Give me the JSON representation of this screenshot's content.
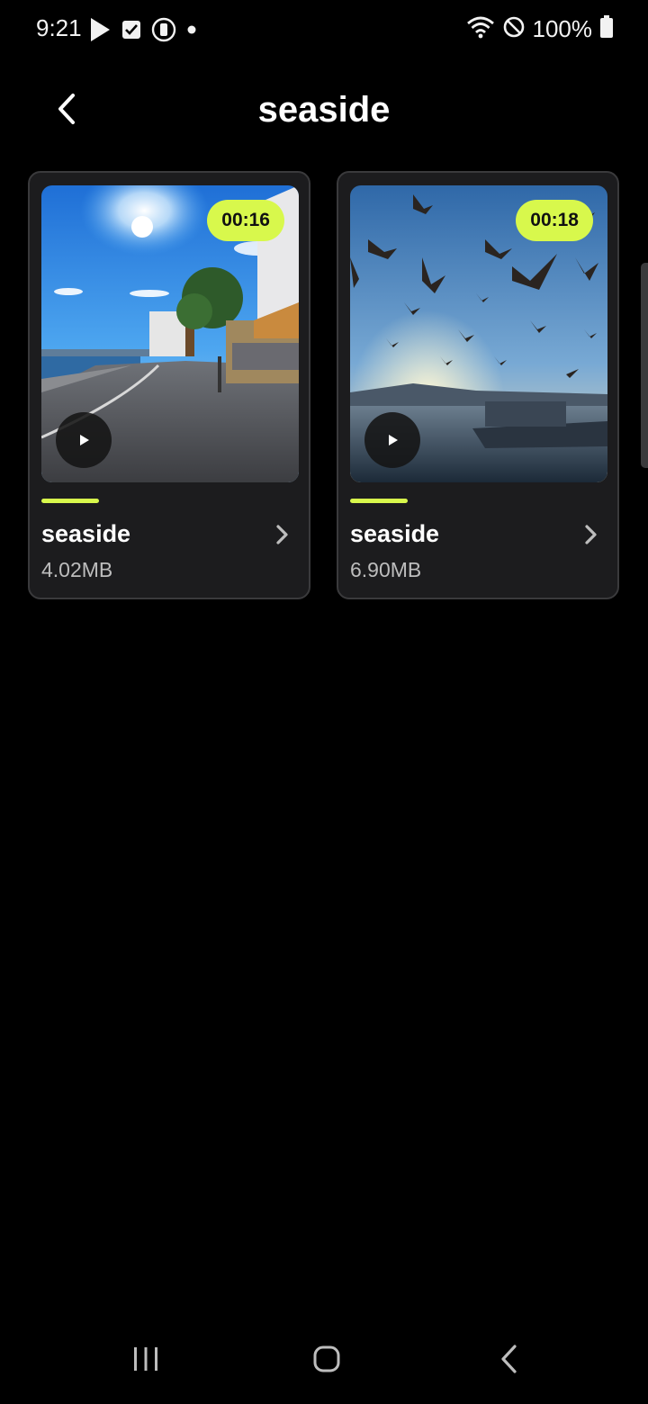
{
  "status_bar": {
    "time": "9:21",
    "left_icons": [
      "play-store-icon",
      "checkbox-icon",
      "recorder-icon",
      "dot-icon"
    ],
    "right_icons": [
      "wifi-icon",
      "do-not-disturb-icon",
      "battery-icon"
    ],
    "battery": "100%"
  },
  "header": {
    "title": "seaside",
    "back_icon": "back-arrow-icon"
  },
  "accent_color": "#d8f84c",
  "videos": [
    {
      "title": "seaside",
      "size": "4.02MB",
      "duration": "00:16",
      "thumbnail": "seaside-road-thumbnail"
    },
    {
      "title": "seaside",
      "size": "6.90MB",
      "duration": "00:18",
      "thumbnail": "seagulls-thumbnail"
    }
  ],
  "nav_bar": {
    "buttons": [
      "recent-apps-icon",
      "home-icon",
      "back-icon"
    ]
  }
}
